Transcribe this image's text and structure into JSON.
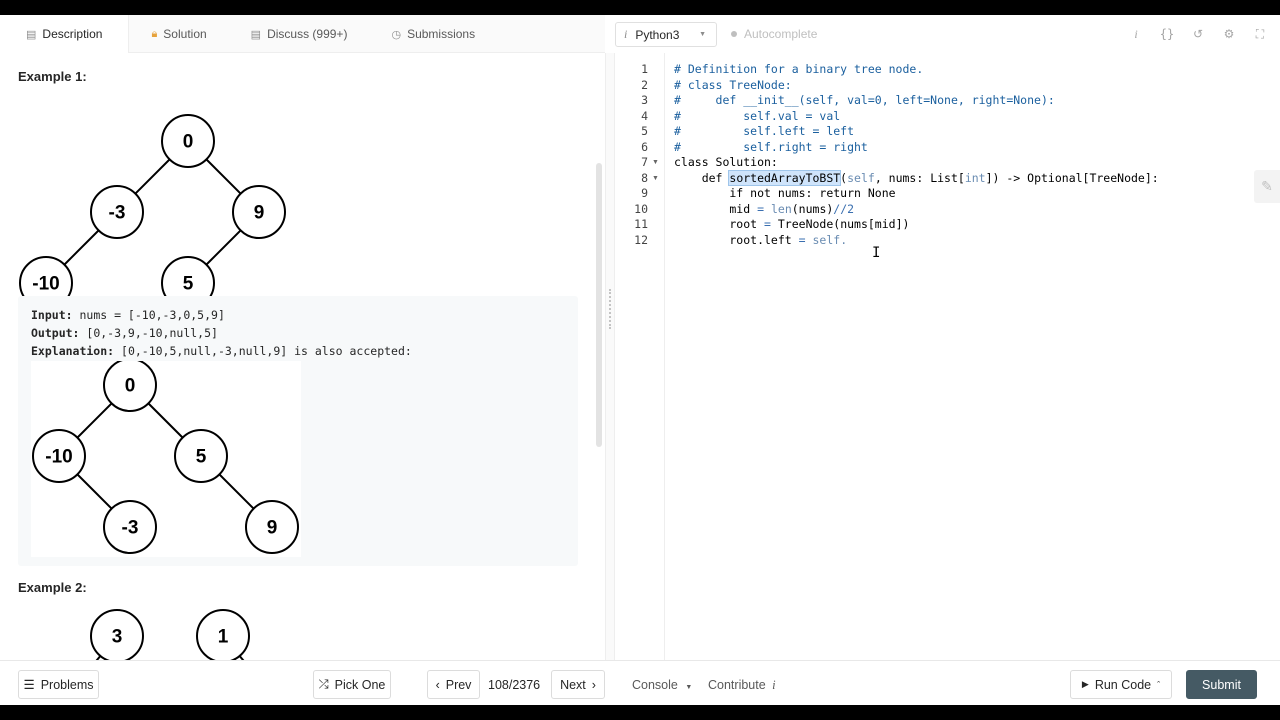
{
  "tabs": [
    {
      "label": "Description",
      "icon": "document-icon",
      "active": true
    },
    {
      "label": "Solution",
      "icon": "lock-icon"
    },
    {
      "label": "Discuss (999+)",
      "icon": "chat-icon"
    },
    {
      "label": "Submissions",
      "icon": "clock-icon"
    }
  ],
  "description": {
    "example1_title": "Example 1:",
    "example2_title": "Example 2:",
    "tree1": [
      "0",
      "-3",
      "9",
      "-10",
      "5"
    ],
    "tree2": [
      "0",
      "-10",
      "5",
      "-3",
      "9"
    ],
    "tree3": [
      "3",
      "1"
    ],
    "input_label": "Input:",
    "input_value": " nums = [-10,-3,0,5,9]",
    "output_label": "Output:",
    "output_value": " [0,-3,9,-10,null,5]",
    "explanation_label": "Explanation:",
    "explanation_value": " [0,-10,5,null,-3,null,9] is also accepted:"
  },
  "editor_toolbar": {
    "language": "Python3",
    "autocomplete": "Autocomplete",
    "icons": [
      "info-icon",
      "braces-icon",
      "reset-icon",
      "settings-icon",
      "fullscreen-icon"
    ]
  },
  "code": {
    "line_numbers": [
      "1",
      "2",
      "3",
      "4",
      "5",
      "6",
      "7",
      "8",
      "9",
      "10",
      "11",
      "12"
    ],
    "line1": "# Definition for a binary tree node.",
    "line2": "# class TreeNode:",
    "line3": "#     def __init__(self, val=0, left=None, right=None):",
    "line4": "#         self.val = val",
    "line5": "#         self.left = left",
    "line6": "#         self.right = right",
    "line7": "class Solution:",
    "line8_indent": "    def ",
    "line8_fn": "sortedArrayToBST",
    "line8_a": "(",
    "line8_self": "self",
    "line8_b": ", nums: List[",
    "line8_int": "int",
    "line8_c": "]) -> Optional[TreeNode]:",
    "line9": "        if not nums: return None",
    "line10_a": "        mid ",
    "line10_eq": "=",
    "line10_sp": " ",
    "line10_len": "len",
    "line10_b": "(nums)",
    "line10_div": "//",
    "line10_two": "2",
    "line11_a": "        root ",
    "line11_eq": "=",
    "line11_b": " TreeNode(nums[mid])",
    "line12_a": "        root.left ",
    "line12_eq": "=",
    "line12_sp": " ",
    "line12_self": "self.",
    "cursor": "I"
  },
  "bottom": {
    "problems": "Problems",
    "pick_one": "Pick One",
    "prev": "Prev",
    "counter": "108/2376",
    "next": "Next",
    "console": "Console",
    "contribute": "Contribute",
    "run_code": "Run Code",
    "submit": "Submit"
  }
}
